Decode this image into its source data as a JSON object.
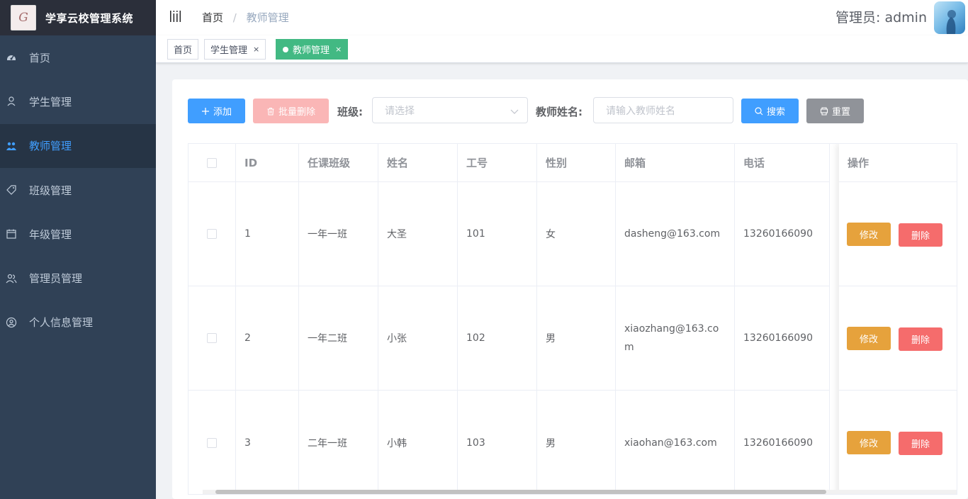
{
  "app": {
    "title": "学享云校管理系统",
    "logo_text": "G"
  },
  "sidebar": {
    "items": [
      {
        "label": "首页",
        "icon": "dashboard-icon",
        "active": false
      },
      {
        "label": "学生管理",
        "icon": "user-icon",
        "active": false
      },
      {
        "label": "教师管理",
        "icon": "peoples-icon",
        "active": true
      },
      {
        "label": "班级管理",
        "icon": "tag-icon",
        "active": false
      },
      {
        "label": "年级管理",
        "icon": "calendar-icon",
        "active": false
      },
      {
        "label": "管理员管理",
        "icon": "user-group-icon",
        "active": false
      },
      {
        "label": "个人信息管理",
        "icon": "user-circle-icon",
        "active": false
      }
    ]
  },
  "header": {
    "breadcrumb": [
      "首页",
      "教师管理"
    ],
    "separator": "/",
    "admin_label": "管理员: admin"
  },
  "tags": [
    {
      "label": "首页",
      "active": false,
      "closable": false
    },
    {
      "label": "学生管理",
      "active": false,
      "closable": true
    },
    {
      "label": "教师管理",
      "active": true,
      "closable": true
    }
  ],
  "toolbar": {
    "add_label": "添加",
    "batch_delete_label": "批量删除",
    "class_label": "班级:",
    "class_placeholder": "请选择",
    "name_label": "教师姓名:",
    "name_placeholder": "请输入教师姓名",
    "search_label": "搜索",
    "reset_label": "重置"
  },
  "table": {
    "headers": [
      "ID",
      "任课班级",
      "姓名",
      "工号",
      "性别",
      "邮箱",
      "电话",
      "操作"
    ],
    "rows": [
      {
        "id": "1",
        "class": "一年一班",
        "name": "大圣",
        "number": "101",
        "gender": "女",
        "email": "dasheng@163.com",
        "phone": "13260166090"
      },
      {
        "id": "2",
        "class": "一年二班",
        "name": "小张",
        "number": "102",
        "gender": "男",
        "email": "xiaozhang@163.com",
        "phone": "13260166090"
      },
      {
        "id": "3",
        "class": "二年一班",
        "name": "小韩",
        "number": "103",
        "gender": "男",
        "email": "xiaohan@163.com",
        "phone": "13260166090"
      }
    ],
    "edit_label": "修改",
    "delete_label": "删除"
  },
  "colors": {
    "sidebar_bg": "#304156",
    "active_menu": "#409eff",
    "primary": "#409eff",
    "success_tag": "#42b983",
    "warning": "#e6a23c",
    "danger": "#f56c6c"
  }
}
